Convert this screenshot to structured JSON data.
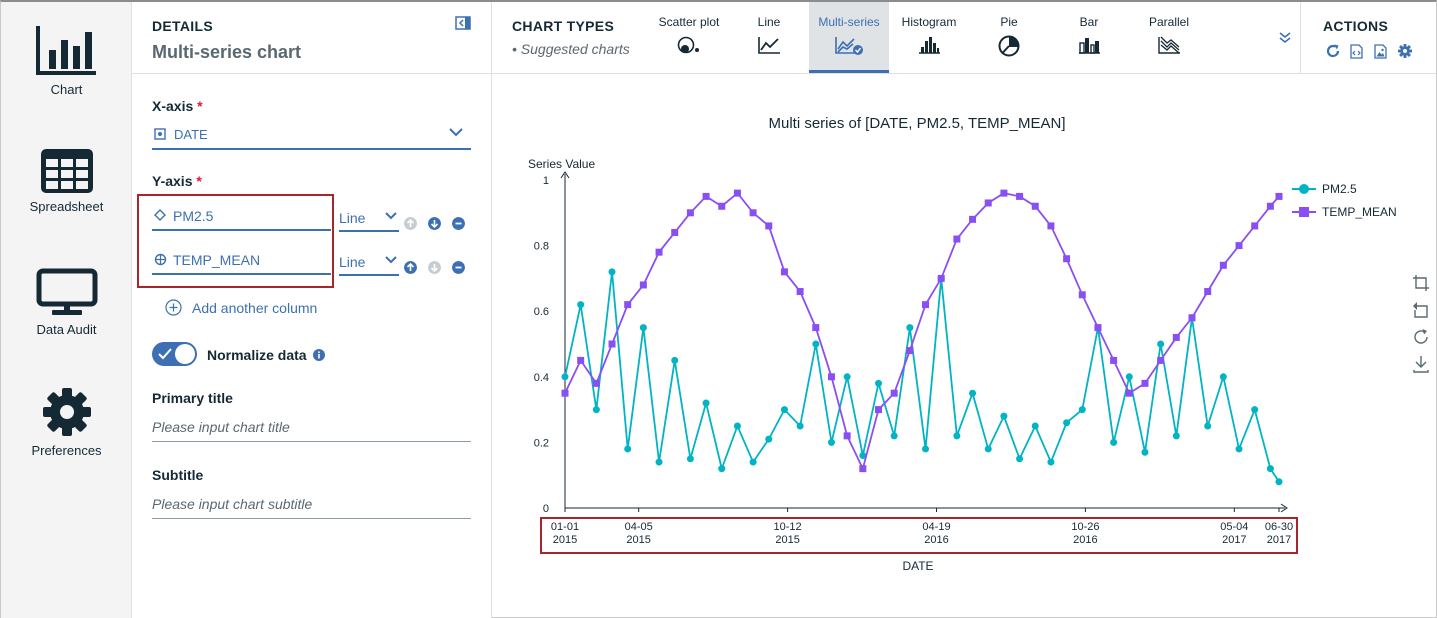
{
  "nav": {
    "items": [
      {
        "label": "Chart",
        "icon": "bar-chart-icon"
      },
      {
        "label": "Spreadsheet",
        "icon": "grid-icon"
      },
      {
        "label": "Data Audit",
        "icon": "monitor-icon"
      },
      {
        "label": "Preferences",
        "icon": "gear-icon"
      }
    ]
  },
  "details": {
    "eyebrow": "DETAILS",
    "title": "Multi-series chart",
    "x_axis_label": "X-axis",
    "x_axis_value": "DATE",
    "y_axis_label": "Y-axis",
    "required_mark": "*",
    "y_columns": [
      {
        "name": "PM2.5",
        "type": "Line"
      },
      {
        "name": "TEMP_MEAN",
        "type": "Line"
      }
    ],
    "add_column": "Add another column",
    "normalize_label": "Normalize data",
    "normalize_on": true,
    "primary_title_label": "Primary title",
    "primary_title_placeholder": "Please input chart title",
    "subtitle_label": "Subtitle",
    "subtitle_placeholder": "Please input chart subtitle"
  },
  "toolbar": {
    "chart_types_title": "CHART TYPES",
    "suggested": "• Suggested charts",
    "types": [
      {
        "label": "Scatter plot",
        "icon": "scatter-icon"
      },
      {
        "label": "Line",
        "icon": "line-icon"
      },
      {
        "label": "Multi-series",
        "icon": "multi-series-icon",
        "active": true
      },
      {
        "label": "Histogram",
        "icon": "histogram-icon"
      },
      {
        "label": "Pie",
        "icon": "pie-icon"
      },
      {
        "label": "Bar",
        "icon": "bar-icon"
      },
      {
        "label": "Parallel",
        "icon": "parallel-icon"
      }
    ],
    "actions_title": "ACTIONS",
    "actions": [
      "refresh-icon",
      "code-icon",
      "image-icon",
      "settings-icon"
    ]
  },
  "colors": {
    "accent": "#3d70b2",
    "pm25": "#00b4c4",
    "temp": "#8a4ff2",
    "highlight_box": "#a8262b"
  },
  "chart_data": {
    "type": "line",
    "title": "Multi series of [DATE, PM2.5, TEMP_MEAN]",
    "ylabel": "Series Value",
    "xlabel": "DATE",
    "ylim": [
      0,
      1
    ],
    "yticks": [
      "0",
      "0.2",
      "0.4",
      "0.6",
      "0.8",
      "1"
    ],
    "xticks": [
      {
        "line1": "01-01",
        "line2": "2015"
      },
      {
        "line1": "04-05",
        "line2": "2015"
      },
      {
        "line1": "10-12",
        "line2": "2015"
      },
      {
        "line1": "04-19",
        "line2": "2016"
      },
      {
        "line1": "10-26",
        "line2": "2016"
      },
      {
        "line1": "05-04",
        "line2": "2017"
      },
      {
        "line1": "06-30",
        "line2": "2017"
      }
    ],
    "xtick_dates": [
      "2015-01-01",
      "2015-04-05",
      "2015-10-12",
      "2016-04-19",
      "2016-10-26",
      "2017-05-04",
      "2017-06-30"
    ],
    "legend_position": "top-right",
    "series": [
      {
        "name": "PM2.5",
        "color": "#00b4c4",
        "marker": "circle",
        "x": [
          "2015-01-01",
          "2015-01-21",
          "2015-02-10",
          "2015-03-02",
          "2015-03-22",
          "2015-04-11",
          "2015-05-01",
          "2015-05-21",
          "2015-06-10",
          "2015-06-30",
          "2015-07-20",
          "2015-08-09",
          "2015-08-29",
          "2015-09-18",
          "2015-10-08",
          "2015-10-28",
          "2015-11-17",
          "2015-12-07",
          "2015-12-27",
          "2016-01-16",
          "2016-02-05",
          "2016-02-25",
          "2016-03-16",
          "2016-04-05",
          "2016-04-25",
          "2016-05-15",
          "2016-06-04",
          "2016-06-24",
          "2016-07-14",
          "2016-08-03",
          "2016-08-23",
          "2016-09-12",
          "2016-10-02",
          "2016-10-22",
          "2016-11-11",
          "2016-12-01",
          "2016-12-21",
          "2017-01-10",
          "2017-01-30",
          "2017-02-19",
          "2017-03-11",
          "2017-03-31",
          "2017-04-20",
          "2017-05-10",
          "2017-05-30",
          "2017-06-19",
          "2017-06-30"
        ],
        "values": [
          0.4,
          0.62,
          0.3,
          0.72,
          0.18,
          0.55,
          0.14,
          0.45,
          0.15,
          0.32,
          0.12,
          0.25,
          0.14,
          0.21,
          0.3,
          0.25,
          0.5,
          0.2,
          0.4,
          0.16,
          0.38,
          0.22,
          0.55,
          0.18,
          0.7,
          0.22,
          0.35,
          0.18,
          0.28,
          0.15,
          0.25,
          0.14,
          0.26,
          0.3,
          0.55,
          0.2,
          0.4,
          0.17,
          0.5,
          0.22,
          0.58,
          0.25,
          0.4,
          0.18,
          0.3,
          0.12,
          0.08
        ]
      },
      {
        "name": "TEMP_MEAN",
        "color": "#8a4ff2",
        "marker": "square",
        "x": [
          "2015-01-01",
          "2015-01-21",
          "2015-02-10",
          "2015-03-02",
          "2015-03-22",
          "2015-04-11",
          "2015-05-01",
          "2015-05-21",
          "2015-06-10",
          "2015-06-30",
          "2015-07-20",
          "2015-08-09",
          "2015-08-29",
          "2015-09-18",
          "2015-10-08",
          "2015-10-28",
          "2015-11-17",
          "2015-12-07",
          "2015-12-27",
          "2016-01-16",
          "2016-02-05",
          "2016-02-25",
          "2016-03-16",
          "2016-04-05",
          "2016-04-25",
          "2016-05-15",
          "2016-06-04",
          "2016-06-24",
          "2016-07-14",
          "2016-08-03",
          "2016-08-23",
          "2016-09-12",
          "2016-10-02",
          "2016-10-22",
          "2016-11-11",
          "2016-12-01",
          "2016-12-21",
          "2017-01-10",
          "2017-01-30",
          "2017-02-19",
          "2017-03-11",
          "2017-03-31",
          "2017-04-20",
          "2017-05-10",
          "2017-05-30",
          "2017-06-19",
          "2017-06-30"
        ],
        "values": [
          0.35,
          0.45,
          0.38,
          0.5,
          0.62,
          0.68,
          0.78,
          0.84,
          0.9,
          0.95,
          0.92,
          0.96,
          0.9,
          0.86,
          0.72,
          0.66,
          0.55,
          0.4,
          0.22,
          0.12,
          0.3,
          0.35,
          0.48,
          0.62,
          0.7,
          0.82,
          0.88,
          0.93,
          0.96,
          0.95,
          0.92,
          0.86,
          0.76,
          0.65,
          0.55,
          0.45,
          0.35,
          0.38,
          0.45,
          0.52,
          0.58,
          0.66,
          0.74,
          0.8,
          0.86,
          0.92,
          0.95
        ]
      }
    ]
  }
}
